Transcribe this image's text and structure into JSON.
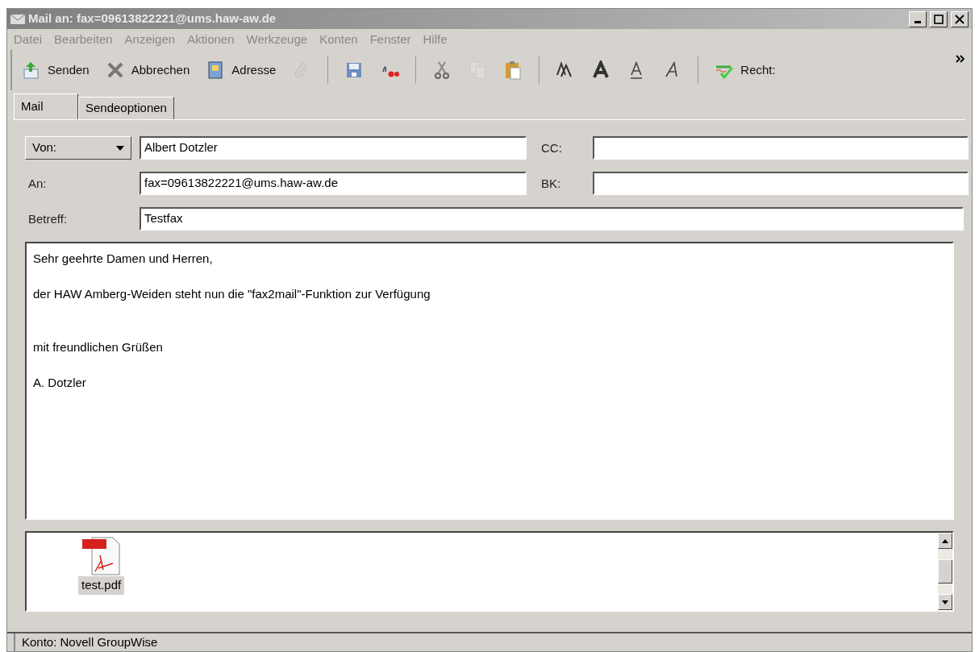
{
  "window": {
    "title": "Mail an: fax=09613822221@ums.haw-aw.de"
  },
  "menu": [
    "Datei",
    "Bearbeiten",
    "Anzeigen",
    "Aktionen",
    "Werkzeuge",
    "Konten",
    "Fenster",
    "Hilfe"
  ],
  "toolbar": [
    {
      "kind": "button",
      "label": "Senden",
      "disabled": false
    },
    {
      "kind": "button",
      "label": "Abbrechen",
      "disabled": false
    },
    {
      "kind": "button",
      "label": "Adresse",
      "disabled": false
    },
    {
      "kind": "button",
      "disabled": true
    },
    {
      "kind": "separator"
    },
    {
      "kind": "button",
      "disabled": false
    },
    {
      "kind": "button",
      "disabled": false
    },
    {
      "kind": "separator"
    },
    {
      "kind": "button",
      "disabled": false
    },
    {
      "kind": "button",
      "disabled": true
    },
    {
      "kind": "button",
      "disabled": false
    },
    {
      "kind": "separator"
    },
    {
      "kind": "button",
      "disabled": false
    },
    {
      "kind": "button",
      "disabled": false
    },
    {
      "kind": "button",
      "disabled": false
    },
    {
      "kind": "button",
      "disabled": false
    },
    {
      "kind": "separator"
    },
    {
      "kind": "button",
      "label": "Recht:",
      "disabled": false
    }
  ],
  "tabs": [
    {
      "label": "Mail",
      "selected": true
    },
    {
      "label": "Sendeoptionen",
      "selected": false
    }
  ],
  "from": {
    "label": "Von:",
    "value": "Albert Dotzler"
  },
  "to": {
    "label": "An:",
    "value": "fax=09613822221@ums.haw-aw.de"
  },
  "subject": {
    "label": "Betreff:",
    "value": "Testfax"
  },
  "cc": {
    "label": "CC:"
  },
  "bc": {
    "label": "BK:"
  },
  "body": "Sehr geehrte Damen und Herren,\n\nder HAW Amberg-Weiden steht nun die \"fax2mail\"-Funktion zur Verfügung\n\n\nmit freundlichen Grüßen\n\nA. Dotzler",
  "attachments": [
    {
      "name": "test.pdf",
      "selected": true
    }
  ],
  "status_bar": "Konto: Novell GroupWise"
}
